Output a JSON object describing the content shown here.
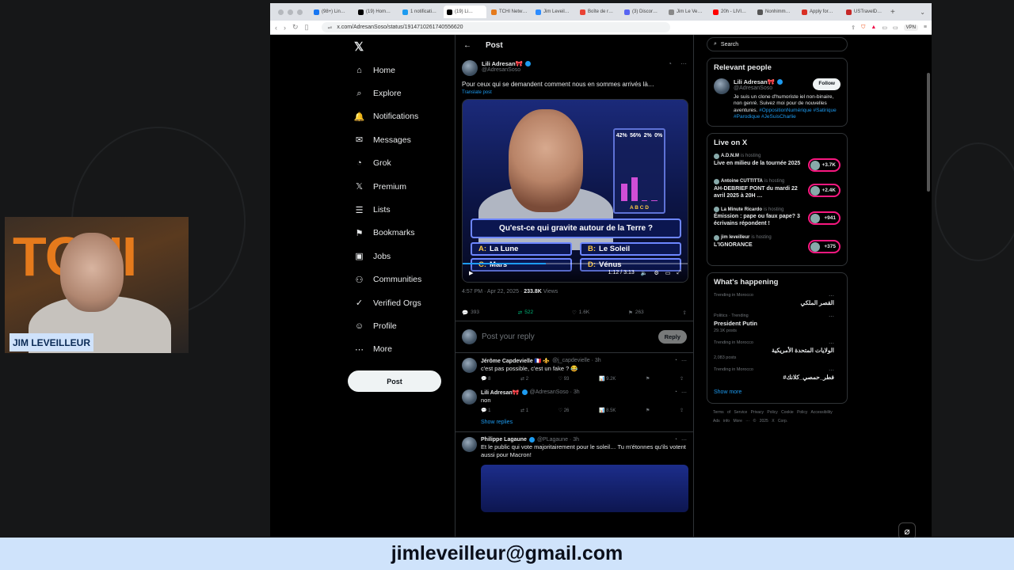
{
  "browser": {
    "tabs": [
      {
        "label": "(98+) Lin…",
        "color": "#1877f2"
      },
      {
        "label": "(19) Hom…",
        "color": "#000000"
      },
      {
        "label": "1 notificati…",
        "color": "#1d9bf0"
      },
      {
        "label": "(19) Li…",
        "color": "#000000"
      },
      {
        "label": "TCHI Netw…",
        "color": "#e57a1c"
      },
      {
        "label": "Jim Leveil…",
        "color": "#2d8cff"
      },
      {
        "label": "Boîte de r…",
        "color": "#ea4335"
      },
      {
        "label": "(3) Discor…",
        "color": "#5865f2"
      },
      {
        "label": "Jim Le Ve…",
        "color": "#888888"
      },
      {
        "label": "20h - LIVI…",
        "color": "#ff0000"
      },
      {
        "label": "Nonhimm…",
        "color": "#555555"
      },
      {
        "label": "Apply for…",
        "color": "#d93025"
      },
      {
        "label": "USTravelD…",
        "color": "#c62828"
      }
    ],
    "url": "x.com/AdresanSoso/status/1914710261740556620",
    "vpn_label": "VPN"
  },
  "nav": {
    "logo": "𝕏",
    "items": [
      {
        "label": "Home",
        "icon": "⌂"
      },
      {
        "label": "Explore",
        "icon": "⌕"
      },
      {
        "label": "Notifications",
        "icon": "🔔"
      },
      {
        "label": "Messages",
        "icon": "✉"
      },
      {
        "label": "Grok",
        "icon": "◔"
      },
      {
        "label": "Premium",
        "icon": "𝕏"
      },
      {
        "label": "Lists",
        "icon": "☰"
      },
      {
        "label": "Bookmarks",
        "icon": "⚑"
      },
      {
        "label": "Jobs",
        "icon": "▣"
      },
      {
        "label": "Communities",
        "icon": "⚇"
      },
      {
        "label": "Verified Orgs",
        "icon": "✓"
      },
      {
        "label": "Profile",
        "icon": "☺"
      },
      {
        "label": "More",
        "icon": "⋯"
      }
    ],
    "post_button": "Post"
  },
  "post": {
    "header": "Post",
    "author": "Lili Adresan🎀",
    "handle": "@AdresanSoso",
    "text": "Pour ceux qui se demandent comment nous en sommes arrivés là…",
    "translate": "Translate post",
    "video": {
      "percents": [
        "42%",
        "56%",
        "2%",
        "0%"
      ],
      "answer_labels": "A  B  C  D",
      "bar_levels": [
        0.42,
        0.56,
        0.02,
        0.0
      ],
      "question": "Qu'est-ce qui gravite autour de la Terre ?",
      "answers": [
        {
          "key": "A:",
          "text": "La Lune"
        },
        {
          "key": "B:",
          "text": "Le Soleil"
        },
        {
          "key": "C:",
          "text": "Mars"
        },
        {
          "key": "D:",
          "text": "Vénus"
        }
      ],
      "time": "1:12 / 3:13",
      "progress": 0.37
    },
    "timestamp": "4:57 PM · Apr 22, 2025 · ",
    "views": "233.8K",
    "views_label": " Views",
    "stats": {
      "replies": "393",
      "reposts": "522",
      "likes": "1.6K",
      "bookmarks": "263"
    },
    "reply_placeholder": "Post your reply",
    "reply_button": "Reply"
  },
  "replies": [
    {
      "author": "Jérôme Capdevielle 🇫🇷 ⚜️",
      "handle": "@j_capdevielle · 3h",
      "text": "c'est pas possible, c'est un fake ? 😂",
      "stats": [
        "8",
        "2",
        "93",
        "9.2K"
      ]
    },
    {
      "author": "Lili Adresan🎀",
      "handle": "@AdresanSoso · 3h",
      "text": "non",
      "stats": [
        "1",
        "1",
        "26",
        "8.5K"
      ]
    },
    {
      "author": "Philippe Lagaune",
      "handle": "@PLagaune · 3h",
      "text": "Et le public qui vote majoritairement pour le soleil… Tu m'étonnes qu'ils votent aussi pour Macron!",
      "stats": []
    }
  ],
  "show_replies": "Show replies",
  "sidebar_right": {
    "search_placeholder": "Search",
    "relevant_title": "Relevant people",
    "relevant": {
      "name": "Lili Adresan🎀",
      "handle": "@AdresanSoso",
      "follow": "Follow",
      "bio": "Je suis un clone d'humoriste iel non-binaire, non genré. Suivez moi pour de nouvelles aventures.",
      "tags": "#OppositionNumérique #Satirique #Parodique #JeSuisCharlie"
    },
    "live_title": "Live on X",
    "live": [
      {
        "host": "A.D.N.M",
        "status": "is hosting",
        "title": "Live en milieu de la tournée 2025",
        "count": "+3.7K"
      },
      {
        "host": "Antoine CUTTITTA",
        "status": "is hosting",
        "title": "AH-DEBRIEF PONT du mardi 22 avril 2025 à 20H …",
        "count": "+2.4K"
      },
      {
        "host": "La Minute Ricardo",
        "status": "is hosting",
        "title": "Émission : pape ou faux pape? 3 écrivains répondent !",
        "count": "+941"
      },
      {
        "host": "jim leveilleur",
        "status": "is hosting",
        "title": "L'IGNORANCE",
        "count": "+375"
      }
    ],
    "happening_title": "What's happening",
    "trends": [
      {
        "meta": "Trending in Morocco",
        "name": "القصر الملكي",
        "posts": "",
        "rtl": true
      },
      {
        "meta": "Politics · Trending",
        "name": "President Putin",
        "posts": "29.1K posts",
        "rtl": false
      },
      {
        "meta": "Trending in Morocco",
        "name": "الولايات المتحدة الأمريكية",
        "posts": "2,083 posts",
        "rtl": true
      },
      {
        "meta": "Trending in Morocco",
        "name": "#فطر_حمصي_كلانك",
        "posts": "",
        "rtl": true
      }
    ],
    "show_more": "Show more",
    "footer": "Terms of Service  Privacy Policy  Cookie Policy  Accessibility  Ads info  More ···  © 2025 X Corp."
  },
  "webcam": {
    "backdrop_text": "TCHI",
    "name_label": "JIM LEVEILLEUR"
  },
  "banner": {
    "email": "jimleveilleur@gmail.com"
  }
}
